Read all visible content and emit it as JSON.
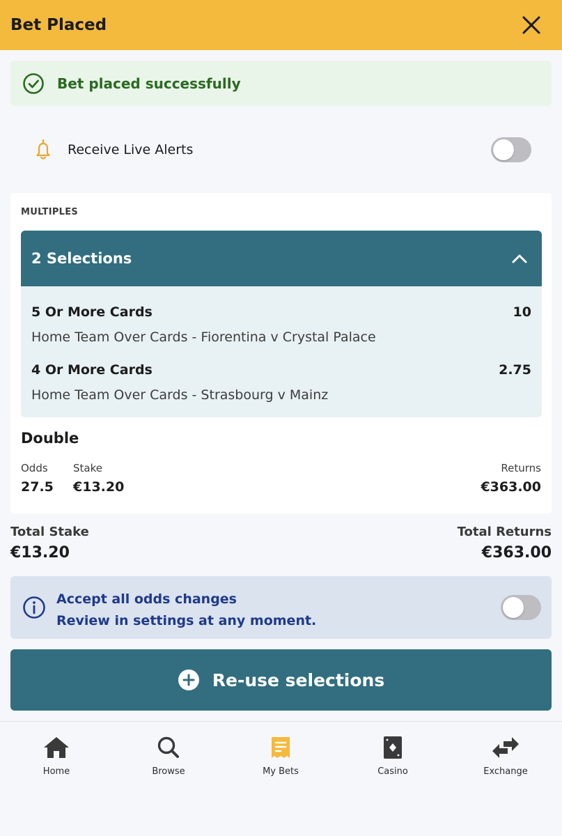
{
  "header": {
    "title": "Bet Placed",
    "close_icon": "close-icon"
  },
  "success": {
    "message": "Bet placed successfully",
    "icon": "check-circle-icon",
    "color": "#2b6a22"
  },
  "alerts": {
    "label": "Receive Live Alerts",
    "icon": "bell-icon",
    "enabled": false
  },
  "bet": {
    "section_label": "MULTIPLES",
    "selections_title": "2 Selections",
    "legs": [
      {
        "title": "5 Or More Cards",
        "odds": "10",
        "description": "Home Team Over Cards - Fiorentina v Crystal Palace"
      },
      {
        "title": "4 Or More Cards",
        "odds": "2.75",
        "description": "Home Team Over Cards - Strasbourg v Mainz"
      }
    ],
    "type": "Double",
    "odds_label": "Odds",
    "odds_value": "27.5",
    "stake_label": "Stake",
    "stake_value": "€13.20",
    "returns_label": "Returns",
    "returns_value": "€363.00"
  },
  "totals": {
    "stake_label": "Total Stake",
    "stake_value": "€13.20",
    "returns_label": "Total Returns",
    "returns_value": "€363.00"
  },
  "odds_changes": {
    "line1": "Accept all odds changes",
    "line2": "Review in settings at any moment.",
    "enabled": false
  },
  "reuse_button": {
    "label": "Re-use selections",
    "icon": "plus-circle-icon"
  },
  "nav": [
    {
      "label": "Home",
      "icon": "home-icon",
      "active": false
    },
    {
      "label": "Browse",
      "icon": "search-icon",
      "active": false
    },
    {
      "label": "My Bets",
      "icon": "receipt-icon",
      "active": true
    },
    {
      "label": "Casino",
      "icon": "card-icon",
      "active": false
    },
    {
      "label": "Exchange",
      "icon": "exchange-icon",
      "active": false
    }
  ],
  "colors": {
    "brand_yellow": "#f4ba3e",
    "teal": "#326e7f",
    "success_bg": "#e9f5e9",
    "info_bg": "#dbe3ef",
    "info_text": "#1f3a8a"
  }
}
